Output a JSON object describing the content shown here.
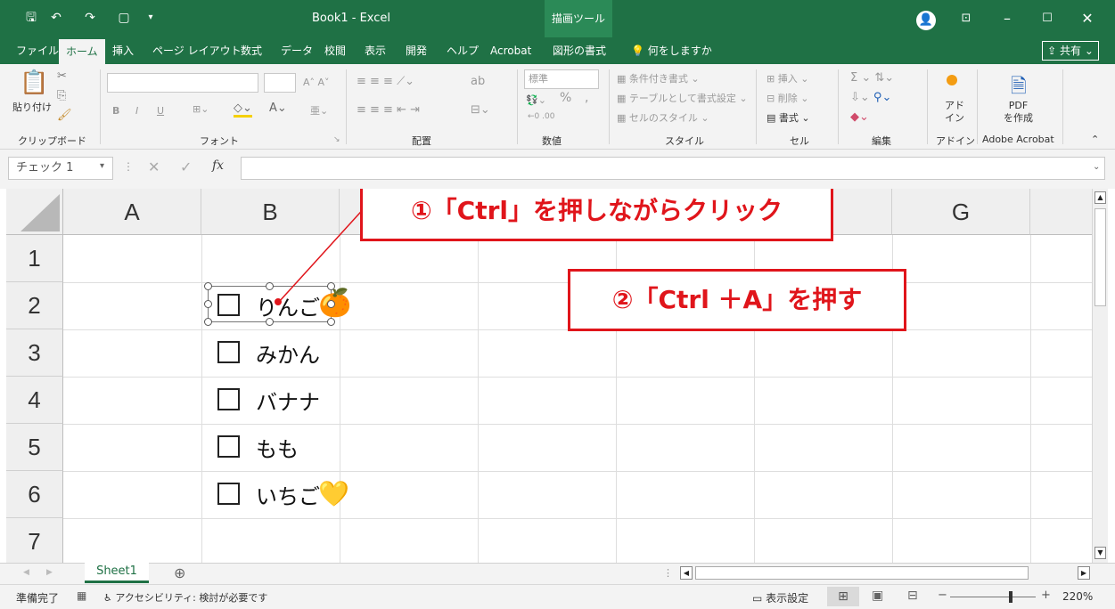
{
  "title_bar": {
    "document_title": "Book1  -  Excel",
    "contextual_tab": "描画ツール",
    "icons": [
      "save-icon",
      "undo-icon",
      "redo-icon",
      "new-icon",
      "customize-icon",
      "account-icon",
      "ribbon-display-icon",
      "minimize-icon",
      "maximize-icon",
      "close-icon"
    ]
  },
  "menu_tabs": [
    "ファイル",
    "ホーム",
    "挿入",
    "ページ レイアウト",
    "数式",
    "データ",
    "校閲",
    "表示",
    "開発",
    "ヘルプ",
    "Acrobat",
    "図形の書式"
  ],
  "active_tab": "ホーム",
  "tell_me": "何をしますか",
  "share_label": "共有",
  "ribbon": {
    "groups": [
      "クリップボード",
      "フォント",
      "配置",
      "数値",
      "スタイル",
      "セル",
      "編集",
      "アドイン",
      "Adobe Acrobat"
    ],
    "clipboard": {
      "paste": "貼り付け"
    },
    "font": {
      "bold": "B",
      "italic": "I",
      "underline": "U"
    },
    "number": {
      "format": "標準",
      "percent": "%",
      "comma": ","
    },
    "styles": {
      "conditional": "条件付き書式",
      "table": "テーブルとして書式設定",
      "cell_styles": "セルのスタイル"
    },
    "cells": {
      "insert": "挿入",
      "delete": "削除",
      "format": "書式"
    },
    "addin": {
      "label": "アド\nイン"
    },
    "acrobat": {
      "label": "PDF\nを作成"
    }
  },
  "formula_bar": {
    "name_box": "チェック 1",
    "fx": "fx",
    "formula": ""
  },
  "grid": {
    "columns": [
      "A",
      "B",
      "",
      "",
      "",
      "",
      "G"
    ],
    "rows": [
      "1",
      "2",
      "3",
      "4",
      "5",
      "6",
      "7"
    ],
    "checkboxes": [
      {
        "label": "りんご",
        "emoji": "🍊"
      },
      {
        "label": "みかん"
      },
      {
        "label": "バナナ"
      },
      {
        "label": "もも"
      },
      {
        "label": "いちご",
        "emoji": "💛"
      }
    ]
  },
  "callouts": {
    "step1": "①「Ctrl」を押しながらクリック",
    "step2": "②「Ctrl ＋A」を押す"
  },
  "sheet_tabs": {
    "sheets": [
      "Sheet1"
    ],
    "add": "⊕"
  },
  "status_bar": {
    "ready": "準備完了",
    "accessibility": "アクセシビリティ: 検討が必要です",
    "display_settings": "表示設定",
    "zoom": "220%"
  },
  "colors": {
    "excel_green": "#1f7145",
    "callout_red": "#e0151b"
  }
}
